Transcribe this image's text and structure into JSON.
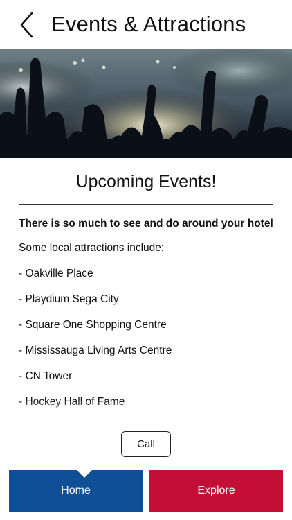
{
  "header": {
    "title": "Events & Attractions",
    "back_icon": "chevron-left-icon"
  },
  "hero": {
    "image": "concert crowd photo"
  },
  "main": {
    "section_title": "Upcoming Events!",
    "intro": "There is so much to see and do around your hotel",
    "paragraph": "Some local attractions include:",
    "attractions": [
      "- Oakville Place",
      "- Playdium Sega City",
      "- Square One Shopping Centre",
      "- Mississauga Living Arts Centre",
      "- CN Tower",
      "- Hockey Hall of Fame"
    ]
  },
  "actions": {
    "call_label": "Call"
  },
  "tabbar": {
    "home_label": "Home",
    "explore_label": "Explore",
    "home_color": "#0f4f98",
    "explore_color": "#c30f35"
  }
}
